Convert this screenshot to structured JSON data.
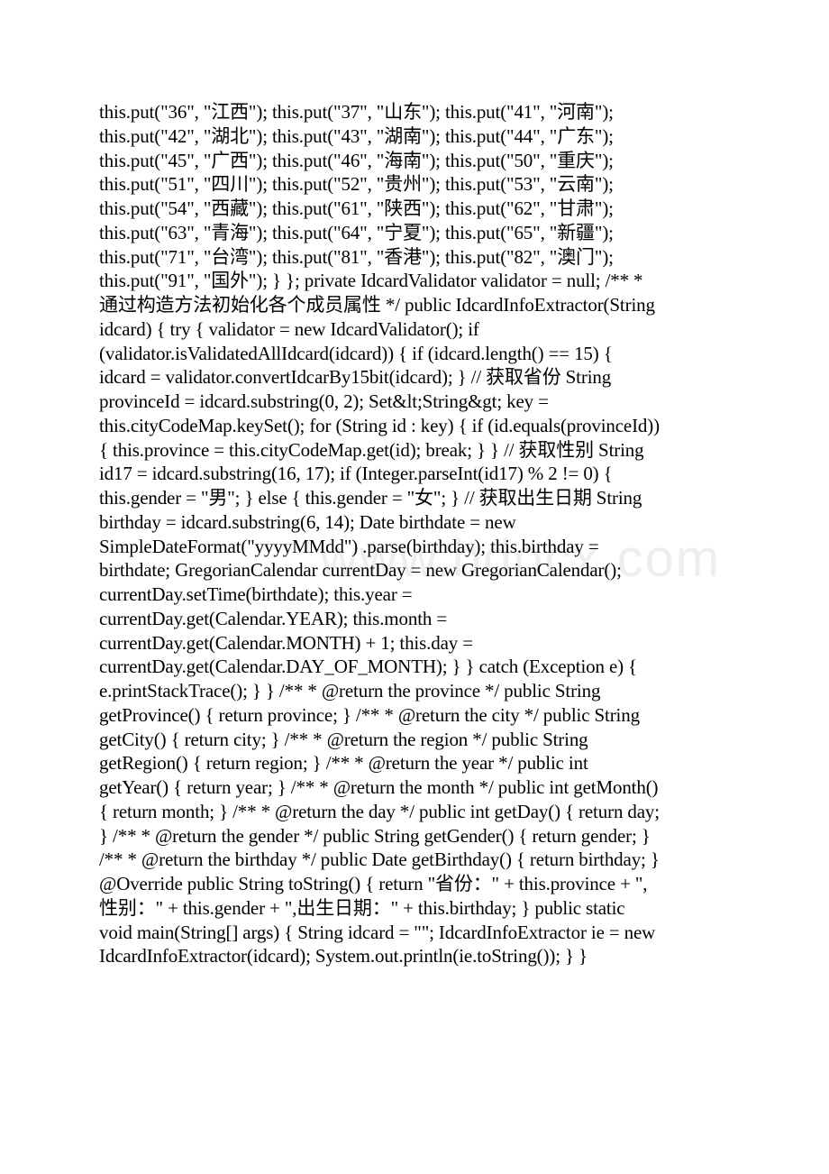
{
  "document": {
    "watermark": "www.bdocx.com",
    "lines": [
      "this.put(\"36\", \"江西\"); this.put(\"37\", \"山东\"); this.put(\"41\", \"河南\");",
      "this.put(\"42\", \"湖北\"); this.put(\"43\", \"湖南\"); this.put(\"44\", \"广东\");",
      "this.put(\"45\", \"广西\"); this.put(\"46\", \"海南\"); this.put(\"50\", \"重庆\");",
      "this.put(\"51\", \"四川\"); this.put(\"52\", \"贵州\"); this.put(\"53\", \"云南\");",
      "this.put(\"54\", \"西藏\"); this.put(\"61\", \"陕西\"); this.put(\"62\", \"甘肃\");",
      "this.put(\"63\", \"青海\"); this.put(\"64\", \"宁夏\"); this.put(\"65\", \"新疆\");",
      "this.put(\"71\", \"台湾\"); this.put(\"81\", \"香港\"); this.put(\"82\", \"澳门\");",
      "this.put(\"91\", \"国外\"); } }; private IdcardValidator validator = null; /** *",
      "通过构造方法初始化各个成员属性 */ public IdcardInfoExtractor(String",
      "idcard) { try { validator = new IdcardValidator(); if",
      "(validator.isValidatedAllIdcard(idcard)) { if (idcard.length() == 15) {",
      "idcard = validator.convertIdcarBy15bit(idcard); } // 获取省份 String",
      "provinceId = idcard.substring(0, 2); Set&lt;String&gt; key =",
      "this.cityCodeMap.keySet(); for (String id : key) { if (id.equals(provinceId))",
      "{ this.province = this.cityCodeMap.get(id); break; } } // 获取性别 String",
      "id17 = idcard.substring(16, 17); if (Integer.parseInt(id17) % 2 != 0) {",
      "this.gender = \"男\"; } else { this.gender = \"女\"; } // 获取出生日期 String",
      "birthday = idcard.substring(6, 14); Date birthdate = new",
      "SimpleDateFormat(\"yyyyMMdd\") .parse(birthday); this.birthday =",
      "birthdate; GregorianCalendar currentDay = new GregorianCalendar();",
      "currentDay.setTime(birthdate); this.year =",
      "currentDay.get(Calendar.YEAR); this.month =",
      "currentDay.get(Calendar.MONTH) + 1; this.day =",
      "currentDay.get(Calendar.DAY_OF_MONTH); } } catch (Exception e) {",
      "e.printStackTrace(); } } /** * @return the province */ public String",
      "getProvince() { return province; } /** * @return the city */ public String",
      "getCity() { return city; } /** * @return the region */ public String",
      "getRegion() { return region; } /** * @return the year */ public int",
      "getYear() { return year; } /** * @return the month */ public int getMonth()",
      "{ return month; } /** * @return the day */ public int getDay() { return day;",
      "} /** * @return the gender */ public String getGender() { return gender; }",
      "/** * @return the birthday */ public Date getBirthday() { return birthday; }",
      "@Override public String toString() { return \"省份：\" + this.province + \",",
      "性别：\" + this.gender + \",出生日期：\" + this.birthday; } public static",
      "void main(String[] args) { String idcard = \"\"; IdcardInfoExtractor ie = new",
      "IdcardInfoExtractor(idcard); System.out.println(ie.toString()); } }"
    ]
  }
}
